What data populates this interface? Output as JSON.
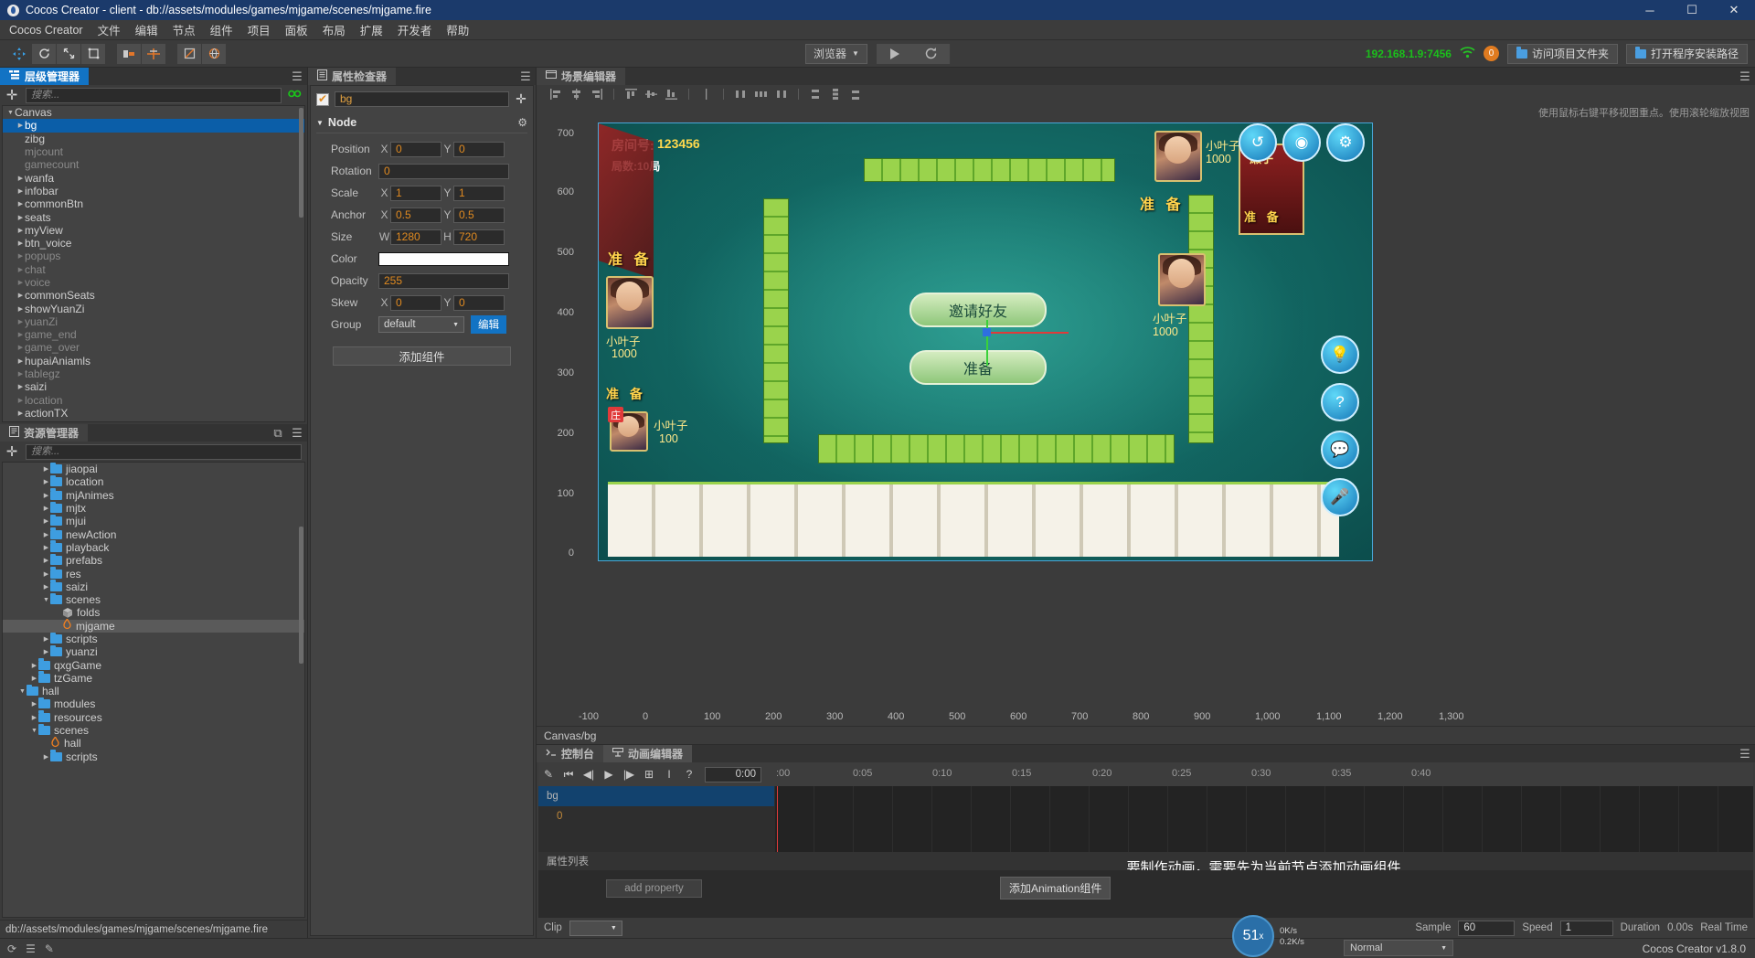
{
  "titlebar": {
    "title": "Cocos Creator - client - db://assets/modules/games/mjgame/scenes/mjgame.fire",
    "minimize": "─",
    "maximize": "☐",
    "close": "✕"
  },
  "menubar": {
    "items": [
      "Cocos Creator",
      "文件",
      "编辑",
      "节点",
      "组件",
      "项目",
      "面板",
      "布局",
      "扩展",
      "开发者",
      "帮助"
    ]
  },
  "toolbar": {
    "preview_target": "浏览器",
    "play_label": "▶",
    "refresh_label": "C",
    "ip": "192.168.1.9:7456",
    "badge": "0",
    "open_project_folder": "访问项目文件夹",
    "open_install_path": "打开程序安装路径"
  },
  "hierarchy": {
    "tab": "层级管理器",
    "search_placeholder": "搜索...",
    "nodes": [
      {
        "label": "Canvas",
        "depth": 0,
        "arrow": "down",
        "dim": false,
        "sel": false
      },
      {
        "label": "bg",
        "depth": 1,
        "arrow": "right",
        "dim": false,
        "sel": true
      },
      {
        "label": "zibg",
        "depth": 1,
        "arrow": "",
        "dim": false,
        "sel": false
      },
      {
        "label": "mjcount",
        "depth": 1,
        "arrow": "",
        "dim": true,
        "sel": false
      },
      {
        "label": "gamecount",
        "depth": 1,
        "arrow": "",
        "dim": true,
        "sel": false
      },
      {
        "label": "wanfa",
        "depth": 1,
        "arrow": "right",
        "dim": false,
        "sel": false
      },
      {
        "label": "infobar",
        "depth": 1,
        "arrow": "right",
        "dim": false,
        "sel": false
      },
      {
        "label": "commonBtn",
        "depth": 1,
        "arrow": "right",
        "dim": false,
        "sel": false
      },
      {
        "label": "seats",
        "depth": 1,
        "arrow": "right",
        "dim": false,
        "sel": false
      },
      {
        "label": "myView",
        "depth": 1,
        "arrow": "right",
        "dim": false,
        "sel": false
      },
      {
        "label": "btn_voice",
        "depth": 1,
        "arrow": "right",
        "dim": false,
        "sel": false
      },
      {
        "label": "popups",
        "depth": 1,
        "arrow": "right",
        "dim": true,
        "sel": false
      },
      {
        "label": "chat",
        "depth": 1,
        "arrow": "right",
        "dim": true,
        "sel": false
      },
      {
        "label": "voice",
        "depth": 1,
        "arrow": "right",
        "dim": true,
        "sel": false
      },
      {
        "label": "commonSeats",
        "depth": 1,
        "arrow": "right",
        "dim": false,
        "sel": false
      },
      {
        "label": "showYuanZi",
        "depth": 1,
        "arrow": "right",
        "dim": false,
        "sel": false
      },
      {
        "label": "yuanZi",
        "depth": 1,
        "arrow": "right",
        "dim": true,
        "sel": false
      },
      {
        "label": "game_end",
        "depth": 1,
        "arrow": "right",
        "dim": true,
        "sel": false
      },
      {
        "label": "game_over",
        "depth": 1,
        "arrow": "right",
        "dim": true,
        "sel": false
      },
      {
        "label": "hupaiAniamls",
        "depth": 1,
        "arrow": "right",
        "dim": false,
        "sel": false
      },
      {
        "label": "tablegz",
        "depth": 1,
        "arrow": "right",
        "dim": true,
        "sel": false
      },
      {
        "label": "saizi",
        "depth": 1,
        "arrow": "right",
        "dim": false,
        "sel": false
      },
      {
        "label": "location",
        "depth": 1,
        "arrow": "right",
        "dim": true,
        "sel": false
      },
      {
        "label": "actionTX",
        "depth": 1,
        "arrow": "right",
        "dim": false,
        "sel": false
      }
    ]
  },
  "assets": {
    "tab": "资源管理器",
    "search_placeholder": "搜索...",
    "items": [
      {
        "label": "jiaopai",
        "depth": 3,
        "icon": "folder",
        "arrow": "right",
        "sel": false
      },
      {
        "label": "location",
        "depth": 3,
        "icon": "folder",
        "arrow": "right",
        "sel": false
      },
      {
        "label": "mjAnimes",
        "depth": 3,
        "icon": "folder",
        "arrow": "right",
        "sel": false
      },
      {
        "label": "mjtx",
        "depth": 3,
        "icon": "folder",
        "arrow": "right",
        "sel": false
      },
      {
        "label": "mjui",
        "depth": 3,
        "icon": "folder",
        "arrow": "right",
        "sel": false
      },
      {
        "label": "newAction",
        "depth": 3,
        "icon": "folder",
        "arrow": "right",
        "sel": false
      },
      {
        "label": "playback",
        "depth": 3,
        "icon": "folder",
        "arrow": "right",
        "sel": false
      },
      {
        "label": "prefabs",
        "depth": 3,
        "icon": "folder",
        "arrow": "right",
        "sel": false
      },
      {
        "label": "res",
        "depth": 3,
        "icon": "folder",
        "arrow": "right",
        "sel": false
      },
      {
        "label": "saizi",
        "depth": 3,
        "icon": "folder",
        "arrow": "right",
        "sel": false
      },
      {
        "label": "scenes",
        "depth": 3,
        "icon": "folder",
        "arrow": "down",
        "sel": false
      },
      {
        "label": "folds",
        "depth": 4,
        "icon": "cube",
        "arrow": "",
        "sel": false
      },
      {
        "label": "mjgame",
        "depth": 4,
        "icon": "fire",
        "arrow": "",
        "sel": true
      },
      {
        "label": "scripts",
        "depth": 3,
        "icon": "folder",
        "arrow": "right",
        "sel": false
      },
      {
        "label": "yuanzi",
        "depth": 3,
        "icon": "folder",
        "arrow": "right",
        "sel": false
      },
      {
        "label": "qxgGame",
        "depth": 2,
        "icon": "folder",
        "arrow": "right",
        "sel": false
      },
      {
        "label": "tzGame",
        "depth": 2,
        "icon": "folder",
        "arrow": "right",
        "sel": false
      },
      {
        "label": "hall",
        "depth": 1,
        "icon": "folder",
        "arrow": "down",
        "sel": false
      },
      {
        "label": "modules",
        "depth": 2,
        "icon": "folder",
        "arrow": "right",
        "sel": false
      },
      {
        "label": "resources",
        "depth": 2,
        "icon": "folder",
        "arrow": "right",
        "sel": false
      },
      {
        "label": "scenes",
        "depth": 2,
        "icon": "folder",
        "arrow": "down",
        "sel": false
      },
      {
        "label": "hall",
        "depth": 3,
        "icon": "fire",
        "arrow": "",
        "sel": false
      },
      {
        "label": "scripts",
        "depth": 3,
        "icon": "folder",
        "arrow": "right",
        "sel": false
      }
    ],
    "path": "db://assets/modules/games/mjgame/scenes/mjgame.fire"
  },
  "inspector": {
    "tab": "属性检查器",
    "node_name": "bg",
    "section": "Node",
    "rows": [
      {
        "label": "Position",
        "a1": "X",
        "v1": "0",
        "a2": "Y",
        "v2": "0"
      },
      {
        "label": "Rotation",
        "a1": "",
        "v1": "0",
        "a2": "",
        "v2": ""
      },
      {
        "label": "Scale",
        "a1": "X",
        "v1": "1",
        "a2": "Y",
        "v2": "1"
      },
      {
        "label": "Anchor",
        "a1": "X",
        "v1": "0.5",
        "a2": "Y",
        "v2": "0.5"
      },
      {
        "label": "Size",
        "a1": "W",
        "v1": "1280",
        "a2": "H",
        "v2": "720"
      },
      {
        "label": "Color",
        "a1": "",
        "v1": "",
        "a2": "",
        "v2": ""
      },
      {
        "label": "Opacity",
        "a1": "",
        "v1": "255",
        "a2": "",
        "v2": ""
      },
      {
        "label": "Skew",
        "a1": "X",
        "v1": "0",
        "a2": "Y",
        "v2": "0"
      },
      {
        "label": "Group",
        "a1": "",
        "v1": "default",
        "a2": "",
        "v2": "编辑"
      }
    ],
    "group_value": "default",
    "group_edit": "编辑",
    "add_component": "添加组件"
  },
  "scene": {
    "tab": "场景编辑器",
    "hint": "使用鼠标右键平移视图重点。使用滚轮缩放视图",
    "breadcrumb": "Canvas/bg",
    "y_ticks": [
      "700",
      "600",
      "500",
      "400",
      "300",
      "200",
      "100",
      "0"
    ],
    "x_ticks": [
      "-100",
      "0",
      "100",
      "200",
      "300",
      "400",
      "500",
      "600",
      "700",
      "800",
      "900",
      "1,000",
      "1,100",
      "1,200",
      "1,300"
    ],
    "room_label": "房间号:",
    "room_number": "123456",
    "round_label": "局数:10局",
    "invite_button": "邀请好友",
    "ready_button": "准备",
    "ready_text": "准 备",
    "laizi_label": "癞子",
    "zhuang_label": "庄",
    "players": [
      {
        "name": "小叶子",
        "score": "1000"
      },
      {
        "name": "小叶子",
        "score": "1000"
      },
      {
        "name": "小叶子",
        "score": "1000"
      },
      {
        "name": "小叶子",
        "score": "100"
      }
    ]
  },
  "animation": {
    "console_tab": "控制台",
    "anim_tab": "动画编辑器",
    "current_time": "0:00",
    "time_ticks": [
      ":00",
      "0:05",
      "0:10",
      "0:15",
      "0:20",
      "0:25",
      "0:30",
      "0:35",
      "0:40"
    ],
    "track_name": "bg",
    "track_value": "0",
    "message": "要制作动画，需要先为当前节点添加动画组件",
    "property_list": "属性列表",
    "add_property": "add property",
    "add_animation": "添加Animation组件",
    "clip_label": "Clip",
    "clip_value": "",
    "sample_label": "Sample",
    "sample_value": "60",
    "speed_label": "Speed",
    "speed_value": "1",
    "duration_label": "Duration",
    "duration_value": "0.00s",
    "realtime_label": "Real Time"
  },
  "statusbar": {
    "fps": "51",
    "fps_unit": "x",
    "net_up": "0K/s",
    "net_down": "0.2K/s",
    "mode": "Normal",
    "version": "Cocos Creator v1.8.0"
  },
  "colors": {
    "accent": "#1273c4",
    "value_orange": "#e08a20",
    "ip_green": "#1bbf1b",
    "folder_blue": "#3e9de0"
  }
}
